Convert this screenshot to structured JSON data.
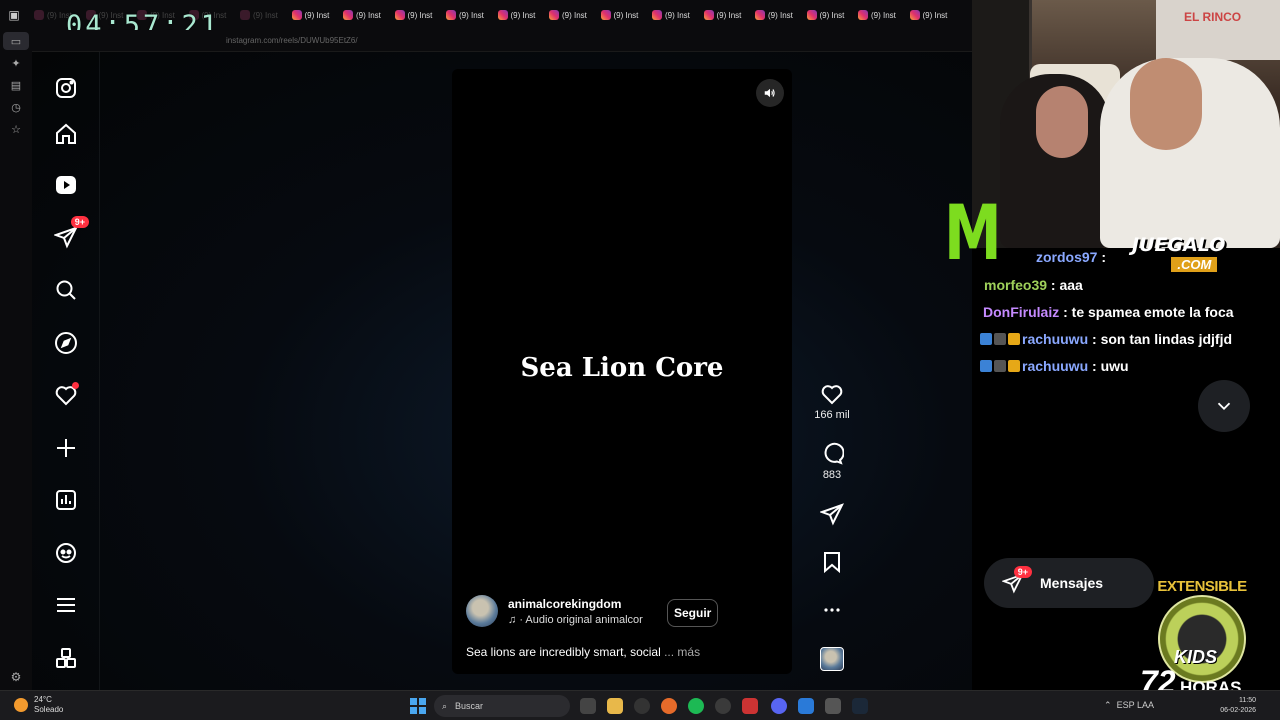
{
  "timer": "04:57:21",
  "browser": {
    "tab_label": "(9) Inst",
    "tabs_dim_count": 5,
    "tabs_count": 13,
    "address": "instagram.com/reels/DUWUb95EtZ6/"
  },
  "instagram": {
    "nav": [
      {
        "name": "instagram-logo-icon"
      },
      {
        "name": "home-icon"
      },
      {
        "name": "reels-icon"
      },
      {
        "name": "messages-icon",
        "badge": "9+"
      },
      {
        "name": "search-icon"
      },
      {
        "name": "explore-icon"
      },
      {
        "name": "notifications-icon",
        "dot": true
      },
      {
        "name": "create-icon"
      },
      {
        "name": "dashboard-icon"
      },
      {
        "name": "threads-icon"
      },
      {
        "name": "menu-icon"
      },
      {
        "name": "apps-icon"
      }
    ],
    "reel": {
      "title": "Sea Lion Core",
      "author": "animalcorekingdom",
      "audio": "· Audio original  animalcor",
      "follow_label": "Seguir",
      "caption": "Sea lions are incredibly smart, social",
      "more_label": "... más"
    },
    "actions": {
      "likes": "166 mil",
      "comments": "883"
    },
    "messages": {
      "label": "Mensajes",
      "badge": "9+"
    }
  },
  "chat": [
    {
      "user": "zordos97",
      "text": " : ",
      "color": "#8aa8ff"
    },
    {
      "user": "morfeo39",
      "text": " : aaa",
      "color": "#9fd05a"
    },
    {
      "user": "DonFirulaiz",
      "text": " : te spamea emote la foca",
      "color": "#c58aff"
    },
    {
      "user": "rachuuwu",
      "text": " : son tan lindas jdjfjd",
      "color": "#8aa8ff",
      "badges": true
    },
    {
      "user": "rachuuwu",
      "text": " : uwu",
      "color": "#8aa8ff",
      "badges": true
    }
  ],
  "overlay": {
    "brand_top": "JUEGALO",
    "brand_bottom": ".COM",
    "sign": "EL RINCO",
    "extensible": "EXTENSIBLE",
    "kids": "KIDS",
    "hours_num": "72",
    "hours_label": "HORAS"
  },
  "taskbar": {
    "temp": "24°C",
    "condition": "Soleado",
    "search_placeholder": "Buscar",
    "lang1": "ESP",
    "lang2": "LAA",
    "time": "11:50",
    "date": "06-02-2026"
  },
  "colors": {
    "accent_red": "#ff3040",
    "timer": "#a9e8d0",
    "monster_green": "#7ddc1f"
  }
}
